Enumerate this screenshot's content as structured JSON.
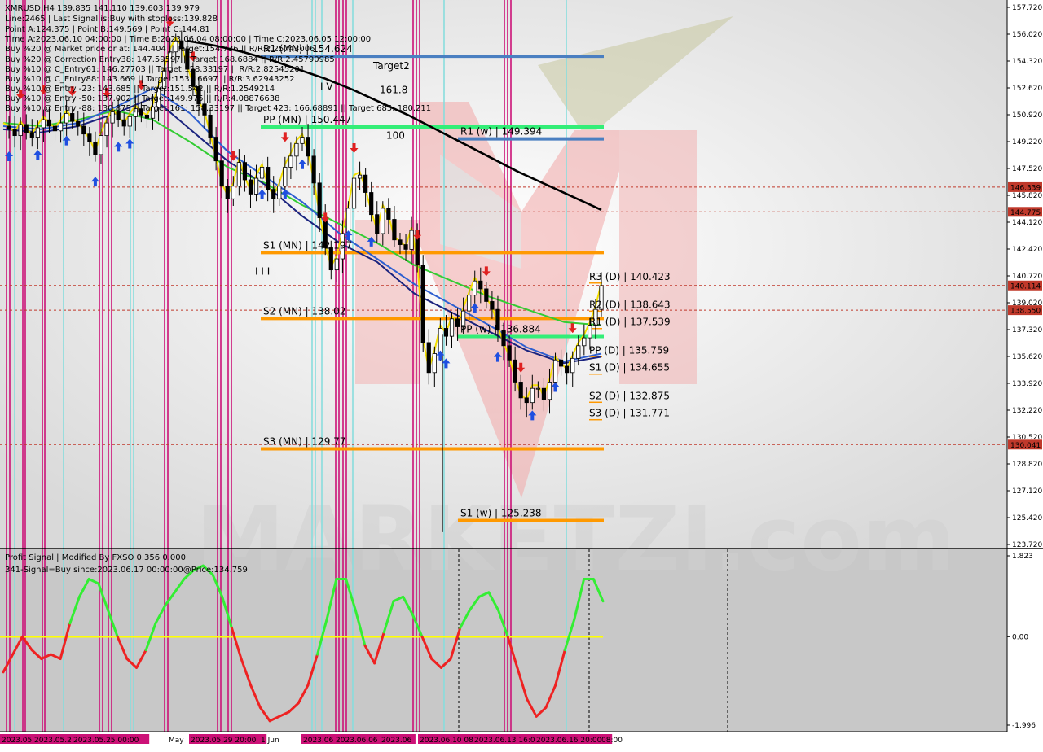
{
  "instrument": {
    "title": "XMRUSD,H4  139.835 141.110 139.603 139.979"
  },
  "info_lines": [
    "Line:2465 | Last Signal is:Buy with stoploss:139.828",
    "Point A:124.375 | Point B:149.569 | Point C:144.81",
    "Time A:2023.06.10 04:00:00 | Time B:2023.06.04 08:00:00 | Time C:2023.06.05 12:00:00",
    "Buy %20 @ Market price or at: 144.404 || Target:154.736 || R/R:2.25743006",
    "Buy %20 @ Correction Entry38: 147.59597 || Target:168.6884 || R/R:2.45790985",
    "Buy %10 @ C_Entry61: 146.27703 || Target:158.33197 || R/R:2.82545201",
    "Buy %10 @ C_Entry88: 143.669 || Target:153.16697 || R/R:3.62943252",
    "Buy %10 @ Entry -23: 143.685 || Target:151.542 || R/R:1.2549214",
    "Buy %10 @ Entry -50: 137.002 || Target:149.975 || R/R:4.08876638",
    "Buy %10 @ Entry -88: 130.875 || Target:161: 158.33197 || Target 423: 166.68891 || Target 685: 180.211"
  ],
  "chart_data": [
    {
      "type": "candlestick",
      "title": "XMRUSD,H4",
      "ylim": [
        123.72,
        157.72
      ],
      "y_ticks": [
        157.72,
        156.02,
        154.32,
        152.62,
        150.92,
        149.22,
        147.52,
        145.82,
        144.12,
        142.42,
        140.72,
        139.02,
        137.32,
        135.62,
        133.92,
        132.22,
        130.52,
        128.82,
        127.12,
        125.42,
        123.72
      ],
      "y_tick_labels": [
        "157.720",
        "156.020",
        "154.320",
        "152.620",
        "150.920",
        "149.220",
        "147.520",
        "145.820",
        "144.120",
        "142.420",
        "140.720",
        "139.020",
        "137.320",
        "135.620",
        "133.920",
        "132.220",
        "130.520",
        "128.820",
        "127.120",
        "125.420",
        "123.720"
      ],
      "price_tags": [
        {
          "value": 146.339,
          "label": "146.339",
          "color": "#c0392b"
        },
        {
          "value": 144.775,
          "label": "144.775",
          "color": "#c0392b"
        },
        {
          "value": 140.114,
          "label": "140.114",
          "color": "#c0392b"
        },
        {
          "value": 138.55,
          "label": "138.550",
          "color": "#c0392b"
        },
        {
          "value": 130.041,
          "label": "130.041",
          "color": "#c0392b"
        }
      ],
      "levels": [
        {
          "label": "R1 (MN) | 154.624",
          "value": 154.624,
          "color": "#4a7fc1",
          "type": "pivot"
        },
        {
          "label": "PP (MN) | 150.447",
          "value": 150.15,
          "color": "#33ee77",
          "type": "pivot"
        },
        {
          "label": "R1 (w) | 149.394",
          "value": 149.394,
          "color": "#4a7fc1",
          "type": "pivot"
        },
        {
          "label": "S1 (MN) | 142.197",
          "value": 142.197,
          "color": "#ff9900",
          "type": "pivot"
        },
        {
          "label": "S2 (MN) | 138.02",
          "value": 138.02,
          "color": "#ff9900",
          "type": "pivot"
        },
        {
          "label": "PP (w) | 136.884",
          "value": 136.884,
          "color": "#33ee77",
          "type": "pivot"
        },
        {
          "label": "S3 (MN) | 129.77",
          "value": 129.77,
          "color": "#ff9900",
          "type": "pivot"
        },
        {
          "label": "S1 (w) | 125.238",
          "value": 125.238,
          "color": "#ff9900",
          "type": "pivot"
        }
      ],
      "daily_levels": [
        {
          "label": "R3 (D) | 140.423",
          "value": 140.423
        },
        {
          "label": "R2 (D) | 138.643",
          "value": 138.643
        },
        {
          "label": "R1 (D) | 137.539",
          "value": 137.539
        },
        {
          "label": "PP (D) | 135.759",
          "value": 135.759
        },
        {
          "label": "S1 (D) | 134.655",
          "value": 134.655
        },
        {
          "label": "S2 (D) | 132.875",
          "value": 132.875
        },
        {
          "label": "S3 (D) | 131.771",
          "value": 131.771
        }
      ],
      "fib_labels": [
        {
          "label": "Target2",
          "value": 154.0,
          "color": "#5cb85c"
        },
        {
          "label": "161.8",
          "value": 152.5,
          "color": "#5cb85c"
        },
        {
          "label": "100",
          "value": 149.6,
          "color": "#5cb85c"
        }
      ],
      "wave_labels": [
        {
          "label": "I V",
          "value": 152.7
        },
        {
          "label": "I I I",
          "value": 141.0
        }
      ],
      "close_series": [
        150.2,
        150.0,
        149.6,
        150.3,
        149.8,
        149.5,
        150.1,
        150.6,
        150.2,
        149.9,
        150.4,
        151.0,
        150.5,
        150.2,
        149.7,
        149.2,
        148.4,
        149.6,
        150.4,
        151.1,
        150.6,
        150.2,
        150.8,
        151.3,
        150.9,
        150.7,
        151.4,
        152.6,
        153.7,
        154.9,
        155.6,
        155.1,
        153.8,
        152.7,
        151.6,
        150.9,
        149.5,
        148.0,
        146.4,
        145.6,
        146.4,
        147.9,
        146.8,
        145.9,
        146.9,
        147.6,
        146.2,
        145.6,
        146.4,
        147.6,
        148.3,
        149.1,
        149.5,
        148.3,
        146.6,
        144.4,
        142.5,
        141.1,
        141.8,
        143.4,
        145.0,
        146.9,
        147.1,
        146.0,
        144.6,
        143.4,
        145.0,
        144.3,
        143.0,
        142.7,
        142.4,
        143.6,
        141.4,
        136.5,
        134.6,
        135.8,
        137.4,
        136.9,
        138.0,
        137.5,
        138.5,
        139.5,
        140.4,
        139.9,
        139.1,
        138.6,
        137.3,
        136.3,
        135.4,
        134.0,
        133.0,
        132.7,
        133.6,
        133.6,
        132.9,
        134.0,
        135.4,
        135.0,
        134.6,
        135.5,
        136.3,
        136.8,
        137.6,
        138.6,
        140.1
      ],
      "ma_series": [
        {
          "color": "#000000",
          "values": [
            155.6,
            155.3,
            154.9,
            154.4,
            153.8,
            153.2,
            152.5,
            151.7,
            150.9,
            150.0,
            149.1,
            148.2,
            147.3,
            146.5,
            145.7,
            144.9
          ]
        },
        {
          "color": "#33cc33",
          "values": [
            150.4,
            150.2,
            150.6,
            151.2,
            150.6,
            149.2,
            147.6,
            146.6,
            145.2,
            144.0,
            142.8,
            141.4,
            140.4,
            139.4,
            138.6,
            137.8,
            137.6
          ]
        },
        {
          "color": "#1a237e",
          "values": [
            150.0,
            149.8,
            150.2,
            151.0,
            152.0,
            150.0,
            148.0,
            146.5,
            144.5,
            142.8,
            141.6,
            139.6,
            138.4,
            137.2,
            136.0,
            135.2,
            135.6
          ]
        },
        {
          "color": "#2e5fd0",
          "values": [
            150.2,
            150.0,
            150.4,
            151.4,
            152.6,
            151.0,
            148.6,
            147.0,
            145.4,
            143.4,
            141.8,
            140.2,
            138.9,
            137.6,
            136.2,
            135.3,
            135.8
          ]
        }
      ],
      "signals": {
        "buy_indices": [
          1,
          6,
          11,
          16,
          20,
          22,
          45,
          49,
          52,
          60,
          64,
          76,
          77,
          82,
          86,
          92,
          96
        ],
        "sell_indices": [
          3,
          7,
          12,
          18,
          24,
          29,
          33,
          40,
          49,
          56,
          61,
          72,
          84,
          90,
          99
        ]
      }
    },
    {
      "type": "line",
      "title": "Profit Signal | Modified By FXSO 0.356 0.000",
      "ylim": [
        -1.996,
        1.823
      ],
      "y_ticks": [
        1.823,
        0.0,
        -1.996
      ],
      "y_tick_labels": [
        "1.823",
        "0.00",
        "-1.996"
      ],
      "series": [
        {
          "name": "",
          "color_positive": "#33ee33",
          "color_negative": "#ee2222",
          "values": [
            -0.8,
            -0.4,
            0.0,
            -0.3,
            -0.5,
            -0.4,
            -0.5,
            0.3,
            0.9,
            1.3,
            1.2,
            0.6,
            0.0,
            -0.5,
            -0.7,
            -0.3,
            0.3,
            0.7,
            1.0,
            1.3,
            1.5,
            1.6,
            1.4,
            0.9,
            0.2,
            -0.5,
            -1.1,
            -1.6,
            -1.9,
            -1.8,
            -1.7,
            -1.5,
            -1.1,
            -0.4,
            0.4,
            1.3,
            1.3,
            0.6,
            -0.2,
            -0.6,
            0.1,
            0.8,
            0.9,
            0.5,
            0.0,
            -0.5,
            -0.7,
            -0.5,
            0.2,
            0.6,
            0.9,
            1.0,
            0.6,
            0.0,
            -0.7,
            -1.4,
            -1.8,
            -1.6,
            -1.1,
            -0.3,
            0.4,
            1.3,
            1.3,
            0.8
          ]
        }
      ],
      "signal_line": {
        "value": 0.0,
        "color": "#ffff00"
      }
    }
  ],
  "indicator": {
    "header": "Profit Signal | Modified By FXSO 0.356 0.000",
    "signal_text": "341-Signal=Buy since:2023.06.17 00:00:00@Price:134.759"
  },
  "time_axis": [
    {
      "label": "2023.05.19"
    },
    {
      "label": "2023.05.22"
    },
    {
      "label": "2023.05.25 00:00"
    },
    {
      "label": "May"
    },
    {
      "label": "2023.05.29 20:00"
    },
    {
      "label": "1 Jun"
    },
    {
      "label": "2023.06.02"
    },
    {
      "label": "2023.06.06"
    },
    {
      "label": "2023.06"
    },
    {
      "label": "2023.06.10 08:00"
    },
    {
      "label": "2023.06.13 16:00"
    },
    {
      "label": "2023.06.16 20:00"
    },
    {
      "label": "08:00"
    }
  ],
  "watermark": {
    "text": "MARKETZI.com"
  },
  "colors": {
    "magenta_line": "#cc1177",
    "cyan_line": "#88dddd",
    "pivot_orange": "#ff9900",
    "pivot_blue": "#4a7fc1",
    "pivot_green": "#33ee77"
  }
}
